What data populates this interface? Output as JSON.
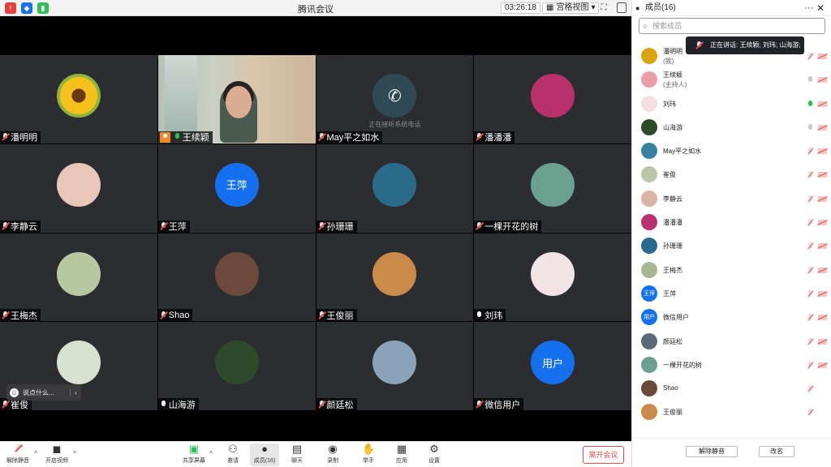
{
  "app": {
    "title": "腾讯会议",
    "timer": "03:26:18",
    "view_label": "宫格视图"
  },
  "tiles": [
    {
      "name": "潘明明",
      "mic": "muted",
      "avatar": "sunflower",
      "bg": "#d9a40f"
    },
    {
      "name": "王续颖",
      "mic": "on",
      "host": true,
      "video": true
    },
    {
      "name": "May平之如水",
      "mic": "muted",
      "avatar": "phone",
      "bg": "#2f4a55",
      "sub": "正在接听系统电话"
    },
    {
      "name": "潘潘潘",
      "mic": "muted",
      "avatar": "art",
      "bg": "#b9316c"
    },
    {
      "name": "李静云",
      "mic": "muted",
      "avatar": "child",
      "bg": "#e9c7b8"
    },
    {
      "name": "王萍",
      "mic": "muted",
      "avatar_text": "王萍",
      "bg": "#1570ef"
    },
    {
      "name": "孙珊珊",
      "mic": "muted",
      "avatar": "person",
      "bg": "#2a6a8a"
    },
    {
      "name": "一棵开花的树",
      "mic": "muted",
      "avatar": "texture",
      "bg": "#6aa08e"
    },
    {
      "name": "王梅杰",
      "mic": "muted",
      "avatar": "field",
      "bg": "#b7c7a0"
    },
    {
      "name": "Shao",
      "mic": "muted",
      "avatar": "woman",
      "bg": "#6b4a3c"
    },
    {
      "name": "王俊丽",
      "mic": "muted",
      "avatar": "sunset",
      "bg": "#c98a4a"
    },
    {
      "name": "刘玮",
      "mic": "on_white",
      "avatar": "doll",
      "bg": "#f2e4e6"
    },
    {
      "name": "崔俊",
      "mic": "muted",
      "avatar": "kid",
      "bg": "#d7e1cf"
    },
    {
      "name": "山海游",
      "mic": "on_white",
      "avatar": "trees",
      "bg": "#2d4a2a"
    },
    {
      "name": "颜廷松",
      "mic": "muted",
      "avatar": "building",
      "bg": "#8aa3b8"
    },
    {
      "name": "微信用户",
      "mic": "muted",
      "avatar_text": "用户",
      "bg": "#1570ef"
    }
  ],
  "chat": {
    "placeholder": "说点什么..."
  },
  "toolbar": {
    "mute": "解除静音",
    "video": "开启视频",
    "share": "共享屏幕",
    "invite": "邀请",
    "members": "成员(16)",
    "chat": "聊天",
    "record": "录制",
    "raise_hand": "举手",
    "apps": "应用",
    "settings": "设置",
    "leave": "离开会议"
  },
  "panel": {
    "title": "成员(16)",
    "search_placeholder": "搜索成员",
    "speaking_tip": "正在讲话: 王续颖; 刘玮; 山海游;",
    "mute_all": "解除静音",
    "rename": "改名",
    "members": [
      {
        "name": "潘明明",
        "sub": "(我)",
        "mic": "muted",
        "cam": "off",
        "bg": "#d9a40f"
      },
      {
        "name": "王续颖",
        "sub": "(主持人)",
        "mic": "grey",
        "cam": "off",
        "bg": "#e8a0a8"
      },
      {
        "name": "刘玮",
        "mic": "green",
        "cam": "off",
        "bg": "#f2dfe2"
      },
      {
        "name": "山海游",
        "mic": "grey",
        "cam": "off",
        "bg": "#2d4a2a"
      },
      {
        "name": "May平之如水",
        "mic": "muted",
        "cam": "off",
        "bg": "#3b7fa0"
      },
      {
        "name": "崔俊",
        "mic": "muted",
        "cam": "off",
        "bg": "#b9c7a8"
      },
      {
        "name": "李静云",
        "mic": "muted",
        "cam": "off",
        "bg": "#d9b5a5"
      },
      {
        "name": "潘潘潘",
        "mic": "muted",
        "cam": "off",
        "bg": "#b9316c"
      },
      {
        "name": "孙珊珊",
        "mic": "muted",
        "cam": "off",
        "bg": "#2a6a8a"
      },
      {
        "name": "王梅杰",
        "mic": "muted",
        "cam": "off",
        "bg": "#a7b890"
      },
      {
        "name": "王萍",
        "mic": "muted",
        "cam": "off",
        "bg": "#1570ef",
        "avatar_text": "王萍"
      },
      {
        "name": "微信用户",
        "mic": "muted",
        "cam": "off",
        "bg": "#1570ef",
        "avatar_text": "用户"
      },
      {
        "name": "颜廷松",
        "mic": "muted",
        "cam": "off",
        "bg": "#5a6a7a"
      },
      {
        "name": "一棵开花的树",
        "mic": "muted",
        "cam": "off",
        "bg": "#6aa08e"
      },
      {
        "name": "Shao",
        "mic": "muted",
        "cam": "none",
        "bg": "#6b4a3c"
      },
      {
        "name": "王俊丽",
        "mic": "muted",
        "cam": "none",
        "bg": "#c98a4a"
      }
    ]
  }
}
